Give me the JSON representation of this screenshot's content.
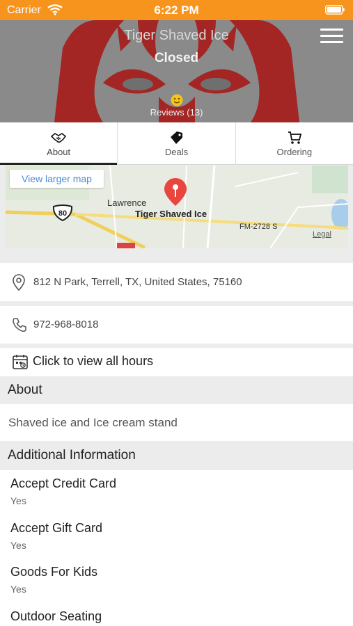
{
  "status_bar": {
    "carrier": "Carrier",
    "time": "6:22 PM",
    "color": "#f7941d"
  },
  "header": {
    "business_name": "Tiger Shaved Ice",
    "status": "Closed",
    "reviews": "Reviews (13)"
  },
  "tabs": [
    {
      "label": "About",
      "icon": "handshake-icon",
      "active": true
    },
    {
      "label": "Deals",
      "icon": "tag-icon",
      "active": false
    },
    {
      "label": "Ordering",
      "icon": "cart-icon",
      "active": false
    }
  ],
  "map": {
    "button": "View larger map",
    "town": "Lawrence",
    "place": "Tiger Shaved Ice",
    "road": "FM-2728 S",
    "highway": "80",
    "legal": "Legal"
  },
  "contact": {
    "address": "812 N Park, Terrell, TX, United States, 75160",
    "phone": "972-968-8018",
    "hours": "Click to view all hours"
  },
  "about": {
    "heading": "About",
    "description": "Shaved ice and Ice cream stand"
  },
  "additional": {
    "heading": "Additional Information",
    "items": [
      {
        "name": "Accept Credit Card",
        "value": "Yes"
      },
      {
        "name": "Accept Gift Card",
        "value": "Yes"
      },
      {
        "name": "Goods For Kids",
        "value": "Yes"
      },
      {
        "name": "Outdoor Seating",
        "value": ""
      }
    ]
  }
}
